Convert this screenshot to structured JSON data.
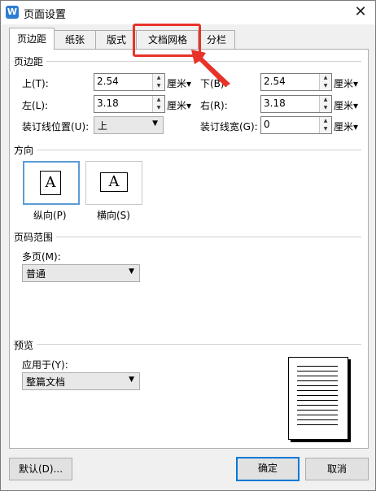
{
  "window": {
    "title": "页面设置",
    "app_icon": "W"
  },
  "tabs": [
    {
      "label": "页边距",
      "active": true
    },
    {
      "label": "纸张"
    },
    {
      "label": "版式"
    },
    {
      "label": "文档网格"
    },
    {
      "label": "分栏"
    }
  ],
  "margins": {
    "group_label": "页边距",
    "top": {
      "label": "上(T):",
      "value": "2.54",
      "unit": "厘米"
    },
    "bottom": {
      "label": "下(B):",
      "value": "2.54",
      "unit": "厘米"
    },
    "left": {
      "label": "左(L):",
      "value": "3.18",
      "unit": "厘米"
    },
    "right": {
      "label": "右(R):",
      "value": "3.18",
      "unit": "厘米"
    },
    "gutter_pos": {
      "label": "装订线位置(U):",
      "value": "上"
    },
    "gutter": {
      "label": "装订线宽(G):",
      "value": "0",
      "unit": "厘米"
    }
  },
  "orientation": {
    "group_label": "方向",
    "portrait": {
      "label": "纵向(P)",
      "glyph": "A"
    },
    "landscape": {
      "label": "横向(S)",
      "glyph": "A"
    }
  },
  "pages": {
    "group_label": "页码范围",
    "multi_label": "多页(M):",
    "multi_value": "普通"
  },
  "preview": {
    "group_label": "预览",
    "apply_label": "应用于(Y):",
    "apply_value": "整篇文档"
  },
  "buttons": {
    "default": "默认(D)...",
    "ok": "确定",
    "cancel": "取消"
  },
  "colors": {
    "highlight": "#e8332a",
    "accent": "#0078d7"
  }
}
